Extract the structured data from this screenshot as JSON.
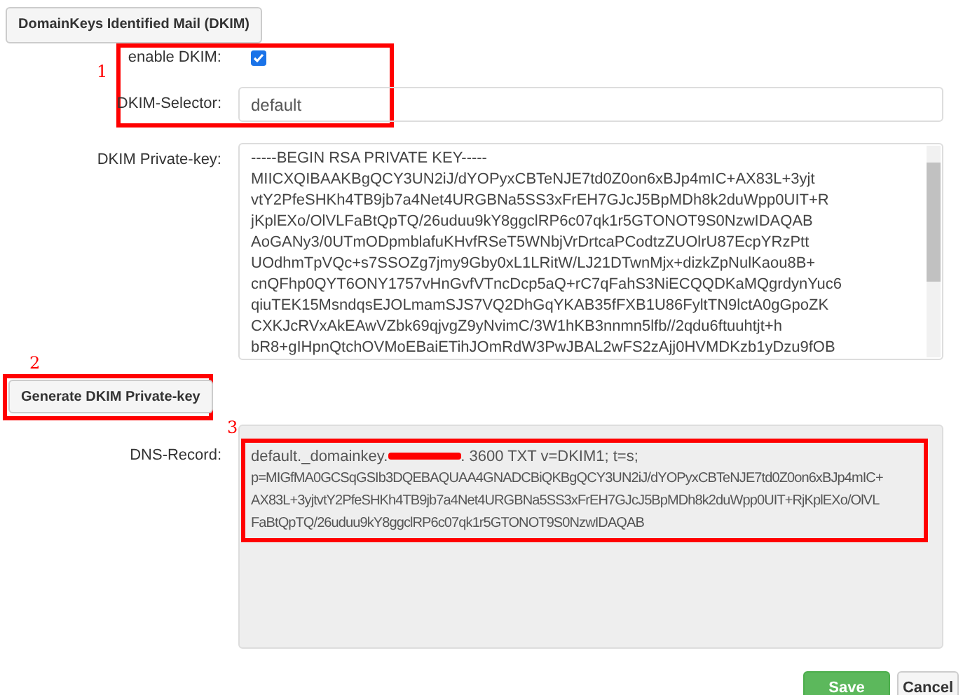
{
  "section_button": "DomainKeys Identified Mail (DKIM)",
  "annotations": [
    {
      "number": "1"
    },
    {
      "number": "2"
    },
    {
      "number": "3"
    }
  ],
  "enable_dkim": {
    "label": "enable DKIM:",
    "checked": true
  },
  "selector": {
    "label": "DKIM-Selector:",
    "value": "default"
  },
  "private_key": {
    "label": "DKIM Private-key:",
    "lines": [
      "-----BEGIN RSA PRIVATE KEY-----",
      "MIICXQIBAAKBgQCY3UN2iJ/dYOPyxCBTeNJE7td0Z0on6xBJp4mIC+AX83L+3yjt",
      "vtY2PfeSHKh4TB9jb7a4Net4URGBNa5SS3xFrEH7GJcJ5BpMDh8k2duWpp0UIT+R",
      "jKplEXo/OlVLFaBtQpTQ/26uduu9kY8ggclRP6c07qk1r5GTONOT9S0NzwIDAQAB",
      "AoGANy3/0UTmODpmblafuKHvfRSeT5WNbjVrDrtcaPCodtzZUOlrU87EcpYRzPtt",
      "UOdhmTpVQc+s7SSOZg7jmy9Gby0xL1LRitW/LJ21DTwnMjx+dizkZpNulKaou8B+",
      "cnQFhp0QYT6ONY1757vHnGvfVTncDcp5aQ+rC7qFahS3NiECQQDKaMQgrdynYuc6",
      "qiuTEK15MsndqsEJOLmamSJS7VQ2DhGqYKAB35fFXB1U86FyltTN9lctA0gGpoZK",
      "CXKJcRVxAkEAwVZbk69qjvgZ9yNvimC/3W1hKB3nnmn5lfb//2qdu6ftuuhtjt+h",
      "bR8+gIHpnQtchOVMoEBaiETihJOmRdW3PwJBAL2wFS2zAjj0HVMDKzb1yDzu9fOB"
    ]
  },
  "generate_button": "Generate DKIM Private-key",
  "dns_record": {
    "label": "DNS-Record:",
    "first_line_start": "default._domainkey.",
    "first_line_end": ". 3600   TXT v=DKIM1; t=s;",
    "lines": [
      "p=MIGfMA0GCSqGSIb3DQEBAQUAA4GNADCBiQKBgQCY3UN2iJ/dYOPyxCBTeNJE7td0Z0on6xBJp4mIC+",
      "AX83L+3yjtvtY2PfeSHKh4TB9jb7a4Net4URGBNa5SS3xFrEH7GJcJ5BpMDh8k2duWpp0UIT+RjKplEXo/OlVL",
      "FaBtQpTQ/26uduu9kY8ggclRP6c07qk1r5GTONOT9S0NzwIDAQAB"
    ]
  },
  "buttons": [
    {
      "label": "Save",
      "kind": "primary"
    },
    {
      "label": "Cancel",
      "kind": "default"
    }
  ]
}
